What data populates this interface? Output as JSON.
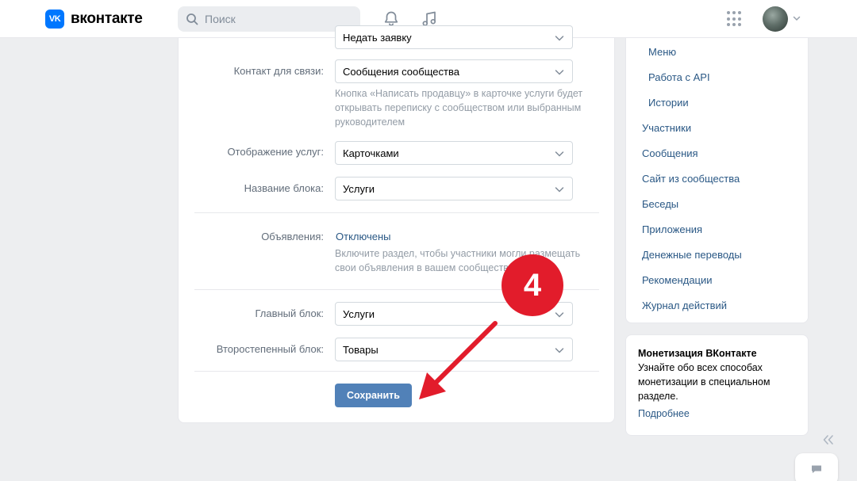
{
  "header": {
    "logo_mark": "VK",
    "logo_text": "вконтакте",
    "search_placeholder": "Поиск"
  },
  "form": {
    "top_select_partial": "Недать заявку",
    "contact": {
      "label": "Контакт для связи:",
      "value": "Сообщения сообщества",
      "hint": "Кнопка «Написать продавцу» в карточке услуги будет открывать переписку с сообществом или выбранным руководителем"
    },
    "display": {
      "label": "Отображение услуг:",
      "value": "Карточками"
    },
    "block_name": {
      "label": "Название блока:",
      "value": "Услуги"
    },
    "ads": {
      "label": "Объявления:",
      "value": "Отключены",
      "hint": "Включите раздел, чтобы участники могли размещать свои объявления в вашем сообществе"
    },
    "main_block": {
      "label": "Главный блок:",
      "value": "Услуги"
    },
    "secondary_block": {
      "label": "Второстепенный блок:",
      "value": "Товары"
    },
    "save_label": "Сохранить"
  },
  "menu": {
    "sub_items": [
      "Меню",
      "Работа с API",
      "Истории"
    ],
    "items": [
      "Участники",
      "Сообщения",
      "Сайт из сообщества",
      "Беседы",
      "Приложения",
      "Денежные переводы",
      "Рекомендации",
      "Журнал действий"
    ]
  },
  "promo": {
    "title": "Монетизация ВКонтакте",
    "text": "Узнайте обо всех способах монетизации в специальном разделе.",
    "link": "Подробнее"
  },
  "annotation": {
    "step": "4",
    "color": "#e21c2b"
  },
  "colors": {
    "accent": "#0077ff",
    "button": "#5181b8",
    "link": "#2a5885"
  }
}
